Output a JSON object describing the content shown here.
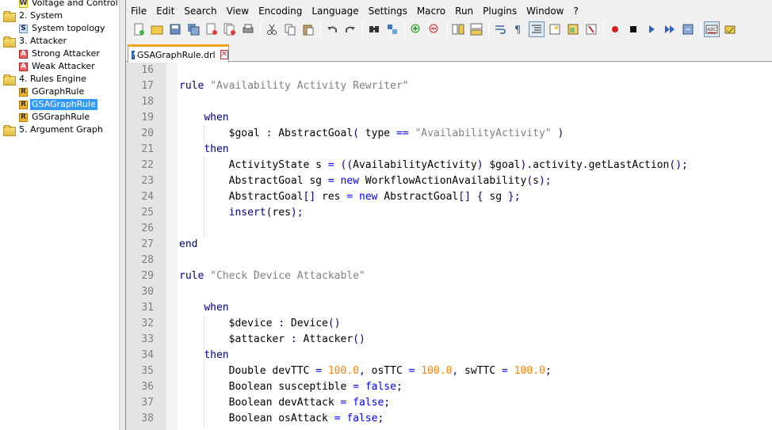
{
  "tree": {
    "items": [
      {
        "badge": "W",
        "label": "Voltage and Control",
        "type": "leaf"
      },
      {
        "label": "2. System",
        "type": "folder"
      },
      {
        "badge": "S",
        "label": "System topology",
        "type": "leaf"
      },
      {
        "label": "3. Attacker",
        "type": "folder"
      },
      {
        "badge": "A",
        "label": "Strong Attacker",
        "type": "leaf"
      },
      {
        "badge": "A",
        "label": "Weak Attacker",
        "type": "leaf"
      },
      {
        "label": "4. Rules Engine",
        "type": "folder"
      },
      {
        "badge": "R",
        "label": "GGraphRule",
        "type": "leaf"
      },
      {
        "badge": "R",
        "label": "GSAGraphRule",
        "type": "leaf",
        "selected": true
      },
      {
        "badge": "R",
        "label": "GSGraphRule",
        "type": "leaf"
      },
      {
        "label": "5. Argument Graph",
        "type": "folder"
      }
    ]
  },
  "menu": [
    "File",
    "Edit",
    "Search",
    "View",
    "Encoding",
    "Language",
    "Settings",
    "Macro",
    "Run",
    "Plugins",
    "Window",
    "?"
  ],
  "toolbar": {
    "icons": [
      "new-file-icon",
      "open-file-icon",
      "save-icon",
      "save-all-icon",
      "close-icon",
      "close-all-icon",
      "print-icon",
      "cut-icon",
      "copy-icon",
      "paste-icon",
      "undo-icon",
      "redo-icon",
      "find-icon",
      "replace-icon",
      "zoom-in-icon",
      "zoom-out-icon",
      "sync-vertical-icon",
      "sync-horizontal-icon",
      "word-wrap-icon",
      "show-all-chars-icon",
      "indent-guide-icon",
      "doc-map-icon",
      "function-list-icon",
      "folder-workspace-icon",
      "record-macro-icon",
      "stop-macro-icon",
      "play-macro-icon",
      "run-macro-multiple-icon",
      "save-macro-icon",
      "spell-check-icon",
      "spell-check-options-icon"
    ]
  },
  "tab": {
    "filename": "GSAGraphRule.drl"
  },
  "code": {
    "lines": [
      {
        "n": "16",
        "t": ""
      },
      {
        "n": "17",
        "t": "rule \"Availability Activity Rewriter\""
      },
      {
        "n": "18",
        "t": ""
      },
      {
        "n": "19",
        "t": "    when"
      },
      {
        "n": "20",
        "t": "        $goal : AbstractGoal( type == \"AvailabilityActivity\" )"
      },
      {
        "n": "21",
        "t": "    then"
      },
      {
        "n": "22",
        "t": "        ActivityState s = ((AvailabilityActivity) $goal).activity.getLastAction();"
      },
      {
        "n": "23",
        "t": "        AbstractGoal sg = new WorkflowActionAvailability(s);"
      },
      {
        "n": "24",
        "t": "        AbstractGoal[] res = new AbstractGoal[] { sg };"
      },
      {
        "n": "25",
        "t": "        insert(res);"
      },
      {
        "n": "26",
        "t": ""
      },
      {
        "n": "27",
        "t": "end"
      },
      {
        "n": "28",
        "t": ""
      },
      {
        "n": "29",
        "t": "rule \"Check Device Attackable\""
      },
      {
        "n": "30",
        "t": ""
      },
      {
        "n": "31",
        "t": "    when"
      },
      {
        "n": "32",
        "t": "        $device : Device()"
      },
      {
        "n": "33",
        "t": "        $attacker : Attacker()"
      },
      {
        "n": "34",
        "t": "    then"
      },
      {
        "n": "35",
        "t": "        Double devTTC = 100.0, osTTC = 100.0, swTTC = 100.0;"
      },
      {
        "n": "36",
        "t": "        Boolean susceptible = false;"
      },
      {
        "n": "37",
        "t": "        Boolean devAttack = false;"
      },
      {
        "n": "38",
        "t": "        Boolean osAttack = false;"
      }
    ]
  },
  "colors": {
    "keyword": "#000080",
    "string": "#808080",
    "number": "#ff8000",
    "operator": "#0000ff",
    "selection": "#3399ff",
    "tab_accent": "#f7a21b"
  }
}
